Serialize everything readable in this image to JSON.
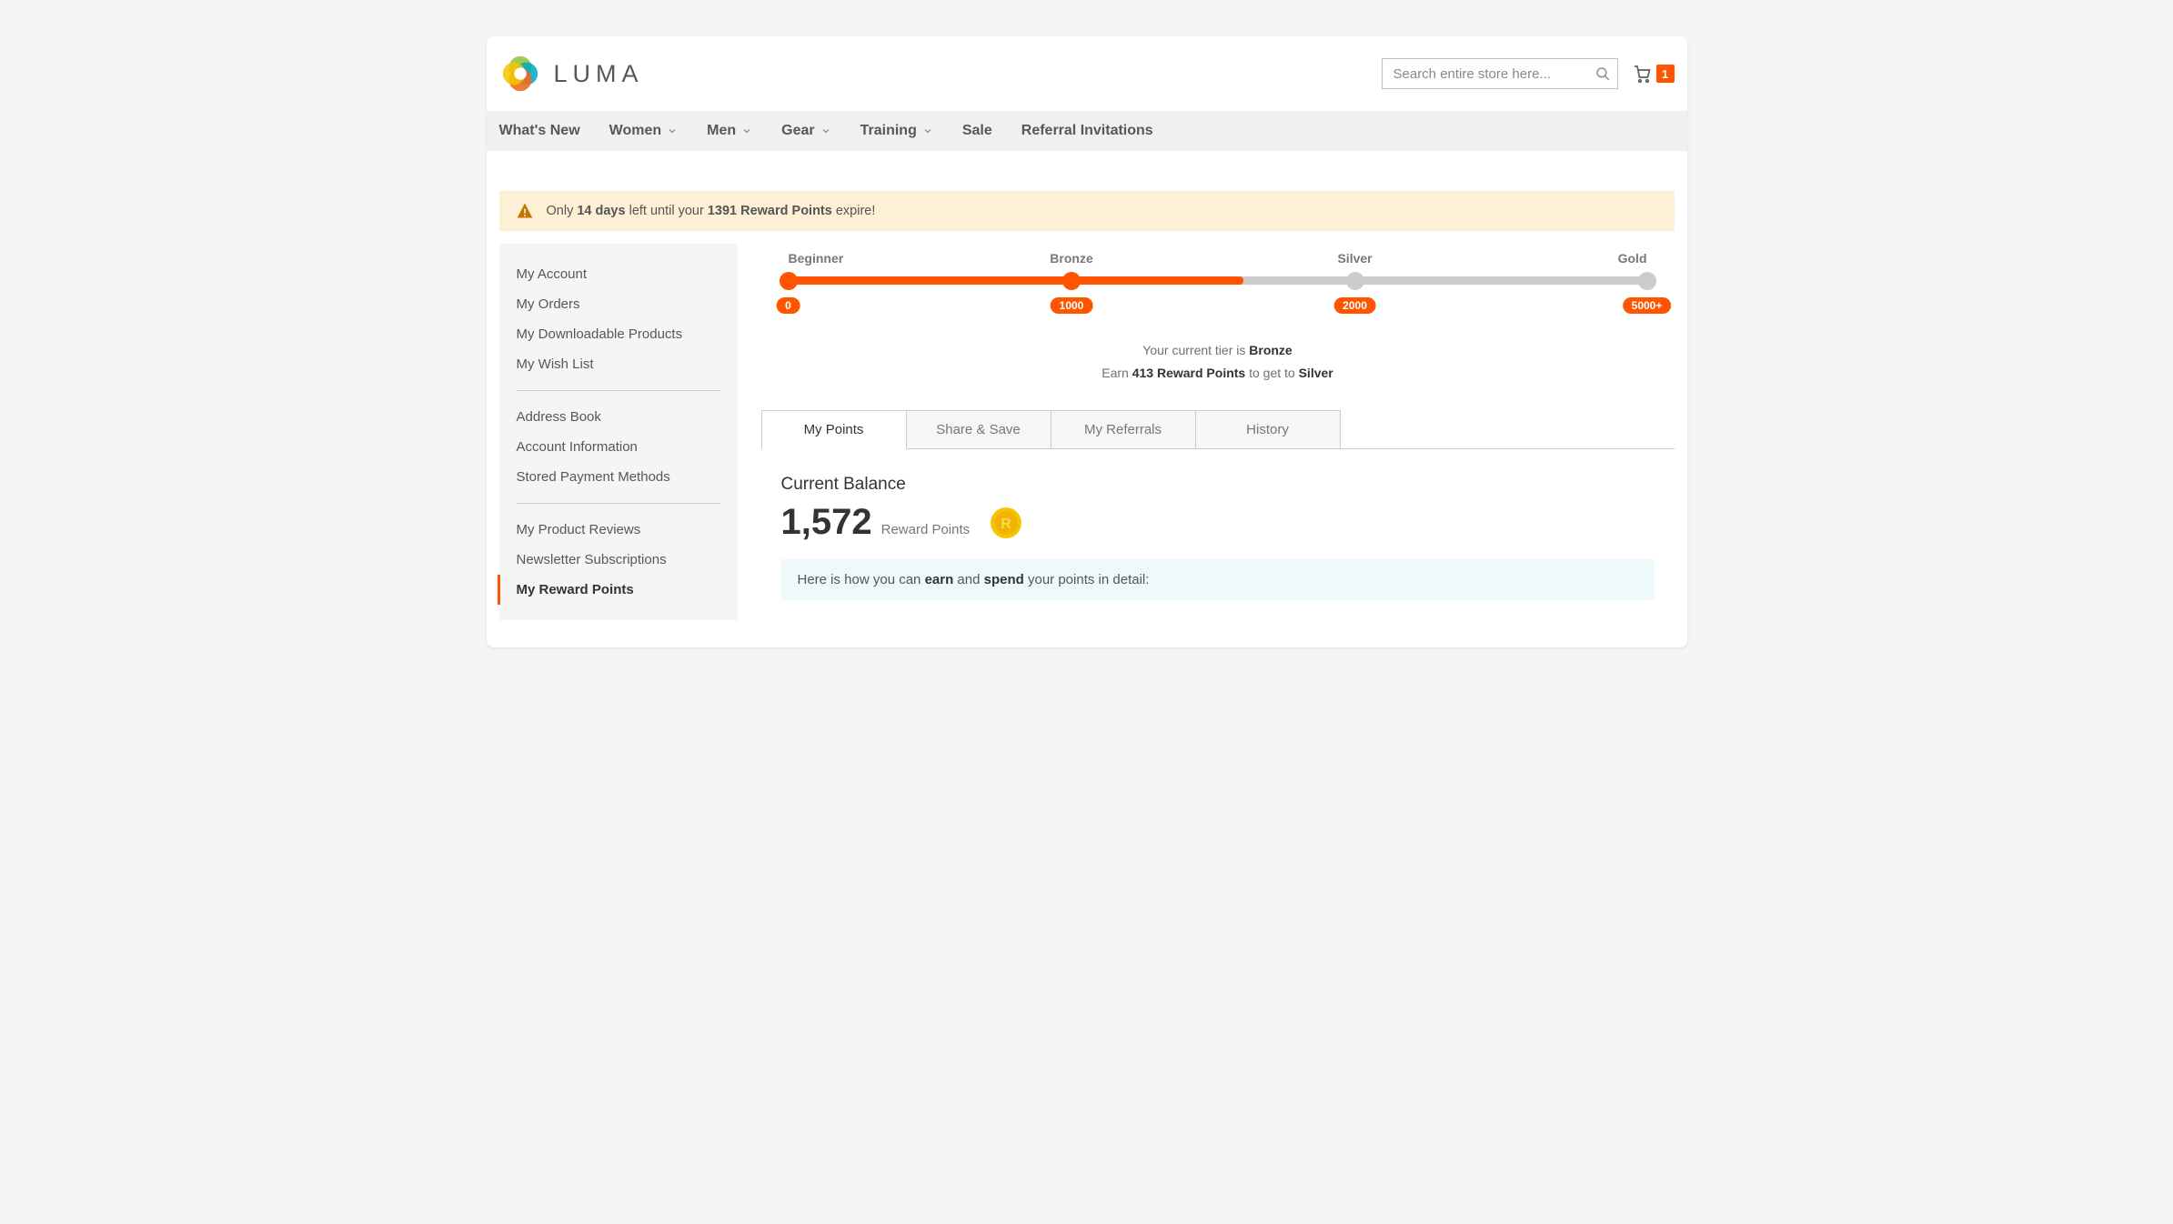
{
  "brand": {
    "name": "LUMA"
  },
  "search": {
    "placeholder": "Search entire store here..."
  },
  "cart": {
    "count": "1"
  },
  "nav": [
    {
      "label": "What's New",
      "dropdown": false
    },
    {
      "label": "Women",
      "dropdown": true
    },
    {
      "label": "Men",
      "dropdown": true
    },
    {
      "label": "Gear",
      "dropdown": true
    },
    {
      "label": "Training",
      "dropdown": true
    },
    {
      "label": "Sale",
      "dropdown": false
    },
    {
      "label": "Referral Invitations",
      "dropdown": false
    }
  ],
  "alert": {
    "pre": "Only ",
    "days": "14 days",
    "mid": " left until your ",
    "points": "1391 Reward Points",
    "post": " expire!"
  },
  "sidebar": {
    "groups": [
      [
        "My Account",
        "My Orders",
        "My Downloadable Products",
        "My Wish List"
      ],
      [
        "Address Book",
        "Account Information",
        "Stored Payment Methods"
      ],
      [
        "My Product Reviews",
        "Newsletter Subscriptions",
        "My Reward Points"
      ]
    ],
    "active": "My Reward Points"
  },
  "tiers": {
    "labels": [
      "Beginner",
      "Bronze",
      "Silver",
      "Gold"
    ],
    "positions_pct": [
      0,
      33,
      66,
      100
    ],
    "pill_values": [
      "0",
      "1000",
      "2000",
      "5000+"
    ],
    "fill_pct": 53,
    "achieved": [
      true,
      true,
      false,
      false
    ],
    "status_line1_pre": "Your current tier is ",
    "status_line1_tier": "Bronze",
    "status_line2_pre": "Earn ",
    "status_line2_points": "413 Reward Points",
    "status_line2_mid": " to get to ",
    "status_line2_next": "Silver"
  },
  "tabs": [
    "My Points",
    "Share & Save",
    "My Referrals",
    "History"
  ],
  "active_tab": "My Points",
  "balance": {
    "heading": "Current Balance",
    "value": "1,572",
    "unit": "Reward Points"
  },
  "info_strip": {
    "pre": "Here is how you can ",
    "w1": "earn",
    "mid": " and ",
    "w2": "spend",
    "post": " your points in detail:"
  }
}
